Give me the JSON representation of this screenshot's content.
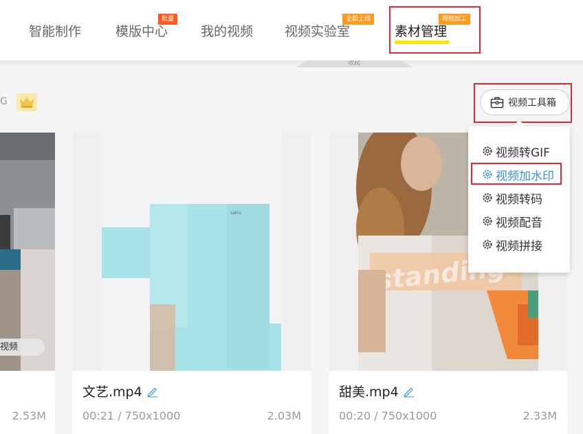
{
  "nav": {
    "items": [
      {
        "label": "智能制作"
      },
      {
        "label": "模版中心",
        "badge": "批量"
      },
      {
        "label": "我的视频"
      },
      {
        "label": "视频实验室",
        "badge": "全新上线"
      },
      {
        "label": "素材管理",
        "badge": "视频加工",
        "active": true
      }
    ],
    "notch_label": "收起"
  },
  "toolbar": {
    "left_fragment": "G",
    "crown_icon": "crown-icon",
    "toolbox_label": "视频工具箱"
  },
  "dropdown": {
    "items": [
      {
        "label": "视频转GIF"
      },
      {
        "label": "视频加水印",
        "highlighted": true
      },
      {
        "label": "视频转码"
      },
      {
        "label": "视频配音"
      },
      {
        "label": "视频拼接"
      }
    ]
  },
  "cards": [
    {
      "pill": "视频",
      "size": "2.53M"
    },
    {
      "title": "文艺.mp4",
      "meta": "00:21 / 750x1000",
      "size": "2.03M"
    },
    {
      "title": "甜美.mp4",
      "meta": "00:20 / 750x1000",
      "size": "2.33M"
    }
  ],
  "colors": {
    "accent_highlight": "#3a8fe0",
    "annotation_red": "#e8242e",
    "nav_underline": "#ffe600",
    "badge_red": "#ff5a1f",
    "badge_orange": "#ff9a1f"
  }
}
